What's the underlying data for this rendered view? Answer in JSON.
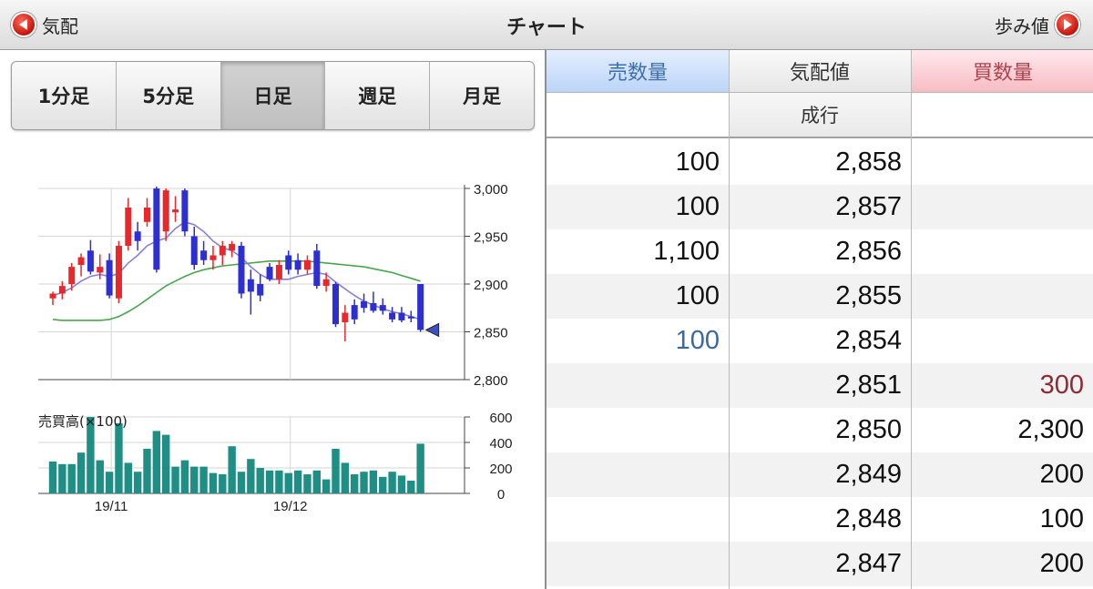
{
  "header": {
    "title": "チャート",
    "back_label": "気配",
    "forward_label": "歩み値"
  },
  "period_tabs": [
    {
      "label": "1分足",
      "active": false
    },
    {
      "label": "5分足",
      "active": false
    },
    {
      "label": "日足",
      "active": true
    },
    {
      "label": "週足",
      "active": false
    },
    {
      "label": "月足",
      "active": false
    }
  ],
  "chart_data": {
    "type": "candlestick",
    "y_ticks": [
      "3,000",
      "2,950",
      "2,900",
      "2,850",
      "2,800"
    ],
    "ylim": [
      2800,
      3000
    ],
    "x_labels": [
      {
        "label": "19/11",
        "index": 6
      },
      {
        "label": "19/12",
        "index": 25
      }
    ],
    "candles": [
      {
        "o": 2885,
        "h": 2892,
        "l": 2878,
        "c": 2890
      },
      {
        "o": 2890,
        "h": 2903,
        "l": 2884,
        "c": 2898
      },
      {
        "o": 2900,
        "h": 2922,
        "l": 2893,
        "c": 2918
      },
      {
        "o": 2920,
        "h": 2932,
        "l": 2908,
        "c": 2928
      },
      {
        "o": 2935,
        "h": 2946,
        "l": 2910,
        "c": 2913
      },
      {
        "o": 2912,
        "h": 2931,
        "l": 2905,
        "c": 2918
      },
      {
        "o": 2925,
        "h": 2932,
        "l": 2885,
        "c": 2888
      },
      {
        "o": 2885,
        "h": 2945,
        "l": 2880,
        "c": 2940
      },
      {
        "o": 2940,
        "h": 2990,
        "l": 2935,
        "c": 2980
      },
      {
        "o": 2955,
        "h": 2965,
        "l": 2935,
        "c": 2945
      },
      {
        "o": 2965,
        "h": 2990,
        "l": 2960,
        "c": 2980
      },
      {
        "o": 3000,
        "h": 3002,
        "l": 2912,
        "c": 2915
      },
      {
        "o": 2955,
        "h": 3000,
        "l": 2945,
        "c": 2998
      },
      {
        "o": 2975,
        "h": 2992,
        "l": 2965,
        "c": 2978
      },
      {
        "o": 2998,
        "h": 3000,
        "l": 2950,
        "c": 2955
      },
      {
        "o": 2950,
        "h": 2960,
        "l": 2915,
        "c": 2920
      },
      {
        "o": 2935,
        "h": 2945,
        "l": 2920,
        "c": 2925
      },
      {
        "o": 2925,
        "h": 2940,
        "l": 2915,
        "c": 2930
      },
      {
        "o": 2930,
        "h": 2945,
        "l": 2920,
        "c": 2940
      },
      {
        "o": 2935,
        "h": 2945,
        "l": 2928,
        "c": 2942
      },
      {
        "o": 2940,
        "h": 2944,
        "l": 2885,
        "c": 2890
      },
      {
        "o": 2905,
        "h": 2915,
        "l": 2868,
        "c": 2892
      },
      {
        "o": 2900,
        "h": 2910,
        "l": 2882,
        "c": 2888
      },
      {
        "o": 2918,
        "h": 2922,
        "l": 2903,
        "c": 2905
      },
      {
        "o": 2905,
        "h": 2925,
        "l": 2900,
        "c": 2920
      },
      {
        "o": 2930,
        "h": 2935,
        "l": 2910,
        "c": 2915
      },
      {
        "o": 2925,
        "h": 2932,
        "l": 2910,
        "c": 2915
      },
      {
        "o": 2915,
        "h": 2930,
        "l": 2910,
        "c": 2925
      },
      {
        "o": 2935,
        "h": 2942,
        "l": 2895,
        "c": 2898
      },
      {
        "o": 2898,
        "h": 2912,
        "l": 2892,
        "c": 2905
      },
      {
        "o": 2900,
        "h": 2902,
        "l": 2855,
        "c": 2858
      },
      {
        "o": 2860,
        "h": 2878,
        "l": 2840,
        "c": 2870
      },
      {
        "o": 2878,
        "h": 2884,
        "l": 2858,
        "c": 2863
      },
      {
        "o": 2882,
        "h": 2890,
        "l": 2870,
        "c": 2875
      },
      {
        "o": 2880,
        "h": 2892,
        "l": 2870,
        "c": 2872
      },
      {
        "o": 2878,
        "h": 2885,
        "l": 2868,
        "c": 2872
      },
      {
        "o": 2870,
        "h": 2876,
        "l": 2860,
        "c": 2863
      },
      {
        "o": 2870,
        "h": 2876,
        "l": 2860,
        "c": 2862
      },
      {
        "o": 2866,
        "h": 2872,
        "l": 2860,
        "c": 2864
      },
      {
        "o": 2900,
        "h": 2900,
        "l": 2850,
        "c": 2852
      }
    ],
    "ma_short": [
      2888,
      2891,
      2896,
      2903,
      2908,
      2910,
      2908,
      2911,
      2922,
      2930,
      2940,
      2945,
      2948,
      2958,
      2965,
      2962,
      2955,
      2945,
      2938,
      2935,
      2928,
      2918,
      2910,
      2905,
      2905,
      2905,
      2908,
      2910,
      2912,
      2910,
      2902,
      2895,
      2888,
      2882,
      2878,
      2874,
      2871,
      2869,
      2866,
      2863
    ],
    "ma_long": [
      2863,
      2862,
      2862,
      2862,
      2862,
      2862,
      2863,
      2866,
      2871,
      2877,
      2884,
      2891,
      2898,
      2903,
      2908,
      2912,
      2915,
      2917,
      2919,
      2920,
      2921,
      2922,
      2923,
      2924,
      2924,
      2924,
      2924,
      2924,
      2923,
      2922,
      2921,
      2920,
      2919,
      2918,
      2916,
      2914,
      2912,
      2909,
      2906,
      2903
    ],
    "up_color": "#e8282a",
    "down_color": "#2d2fd0",
    "ma_short_color": "#8a7fd8",
    "ma_long_color": "#4aa64a",
    "volume_label": "売買高(×100)",
    "volume_ticks": [
      "600",
      "400",
      "200",
      "0"
    ],
    "volume_ylim": [
      0,
      600
    ],
    "volume_color": "#1f8f86",
    "volume": [
      250,
      230,
      230,
      320,
      600,
      260,
      170,
      550,
      240,
      170,
      350,
      490,
      460,
      210,
      260,
      210,
      210,
      160,
      150,
      370,
      170,
      270,
      200,
      180,
      180,
      160,
      180,
      150,
      180,
      110,
      350,
      240,
      150,
      170,
      180,
      130,
      170,
      140,
      100,
      390
    ]
  },
  "board": {
    "headers": {
      "sell": "売数量",
      "price": "気配値",
      "buy": "買数量"
    },
    "market_order": "成行",
    "rows": [
      {
        "sell": "100",
        "price": "2,858",
        "buy": ""
      },
      {
        "sell": "100",
        "price": "2,857",
        "buy": ""
      },
      {
        "sell": "1,100",
        "price": "2,856",
        "buy": ""
      },
      {
        "sell": "100",
        "price": "2,855",
        "buy": ""
      },
      {
        "sell": "100",
        "price": "2,854",
        "buy": "",
        "sell_highlight": true
      },
      {
        "sell": "",
        "price": "2,851",
        "buy": "300",
        "buy_highlight": true
      },
      {
        "sell": "",
        "price": "2,850",
        "buy": "2,300"
      },
      {
        "sell": "",
        "price": "2,849",
        "buy": "200"
      },
      {
        "sell": "",
        "price": "2,848",
        "buy": "100"
      },
      {
        "sell": "",
        "price": "2,847",
        "buy": "200"
      }
    ]
  }
}
